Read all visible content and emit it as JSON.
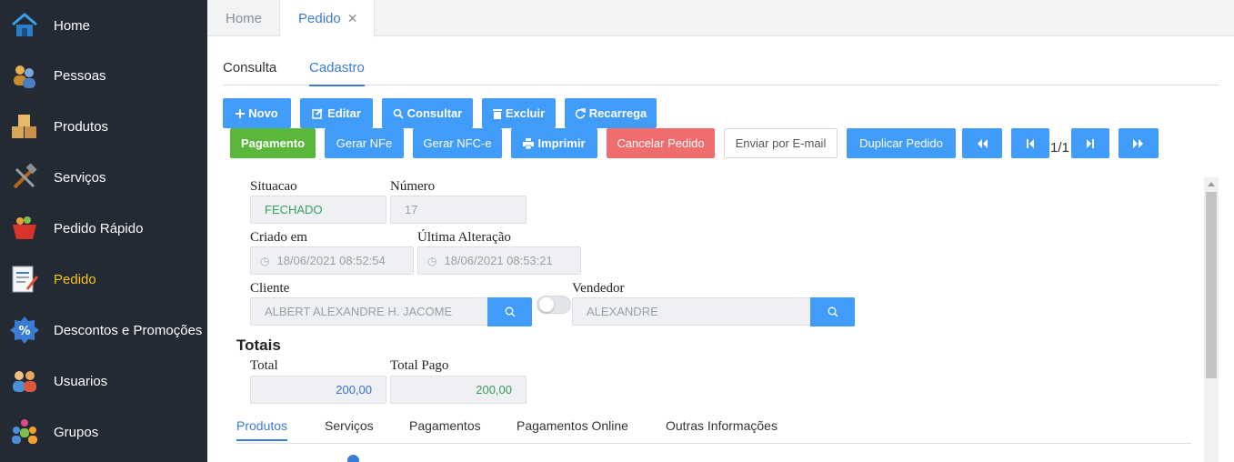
{
  "sidebar": {
    "items": [
      {
        "label": "Home",
        "icon": "home-icon"
      },
      {
        "label": "Pessoas",
        "icon": "people-icon"
      },
      {
        "label": "Produtos",
        "icon": "boxes-icon"
      },
      {
        "label": "Serviços",
        "icon": "tools-icon"
      },
      {
        "label": "Pedido Rápido",
        "icon": "basket-icon"
      },
      {
        "label": "Pedido",
        "icon": "order-document-icon"
      },
      {
        "label": "Descontos e Promoções",
        "icon": "discount-badge-icon"
      },
      {
        "label": "Usuarios",
        "icon": "users-icon"
      },
      {
        "label": "Grupos",
        "icon": "groups-icon"
      }
    ],
    "active": "Pedido",
    "active_color": "#f5c518"
  },
  "tabs": {
    "home": "Home",
    "pedido": "Pedido",
    "close_glyph": "✕"
  },
  "subtabs": {
    "consulta": "Consulta",
    "cadastro": "Cadastro"
  },
  "toolbar": {
    "novo": "Novo",
    "editar": "Editar",
    "consultar": "Consultar",
    "excluir": "Excluir",
    "recarrega": "Recarrega",
    "pagamento": "Pagamento",
    "gerar_nfe": "Gerar NFe",
    "gerar_nfce": "Gerar NFC-e",
    "imprimir": "Imprimir",
    "cancelar_pedido": "Cancelar Pedido",
    "enviar_email": "Enviar por E-mail",
    "duplicar_pedido": "Duplicar Pedido",
    "pager": "1/1"
  },
  "form": {
    "situacao_label": "Situacao",
    "situacao_value": "FECHADO",
    "numero_label": "Número",
    "numero_value": "17",
    "criado_label": "Criado em",
    "criado_value": "18/06/2021 08:52:54",
    "alteracao_label": "Última Alteração",
    "alteracao_value": "18/06/2021 08:53:21",
    "cliente_label": "Cliente",
    "cliente_value": "ALBERT ALEXANDRE H. JACOME",
    "vendedor_label": "Vendedor",
    "vendedor_value": "ALEXANDRE",
    "totais_title": "Totais",
    "total_label": "Total",
    "total_value": "200,00",
    "total_pago_label": "Total Pago",
    "total_pago_value": "200,00"
  },
  "bottom_tabs": {
    "produtos": "Produtos",
    "servicos": "Serviços",
    "pagamentos": "Pagamentos",
    "pagamentos_online": "Pagamentos Online",
    "outras": "Outras Informações"
  },
  "colors": {
    "sidebar_bg": "#232a33",
    "accent_blue": "#419bf9",
    "green": "#5ab73b",
    "red": "#ef6d6d"
  }
}
